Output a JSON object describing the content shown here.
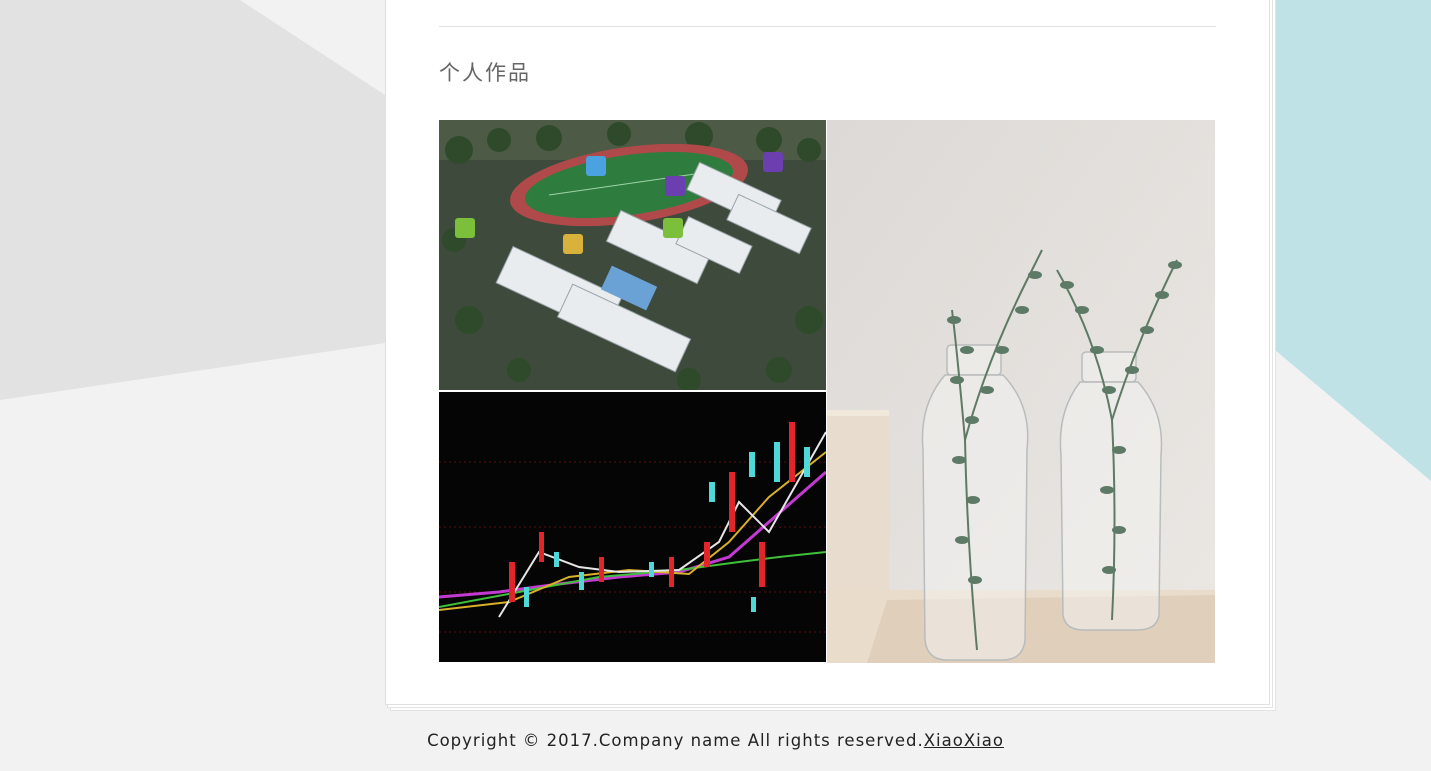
{
  "portfolio": {
    "title": "个人作品",
    "items": [
      {
        "name": "campus-aerial-render"
      },
      {
        "name": "stock-candlestick-chart"
      },
      {
        "name": "eucalyptus-glass-bottles"
      }
    ]
  },
  "footer": {
    "copyright": "Copyright © 2017.Company name All rights reserved.",
    "link": "XiaoXiao"
  },
  "colors": {
    "background": "#f2f2f2",
    "accent_teal": "#bfe2e6",
    "shape_gray": "#e2e2e2"
  }
}
